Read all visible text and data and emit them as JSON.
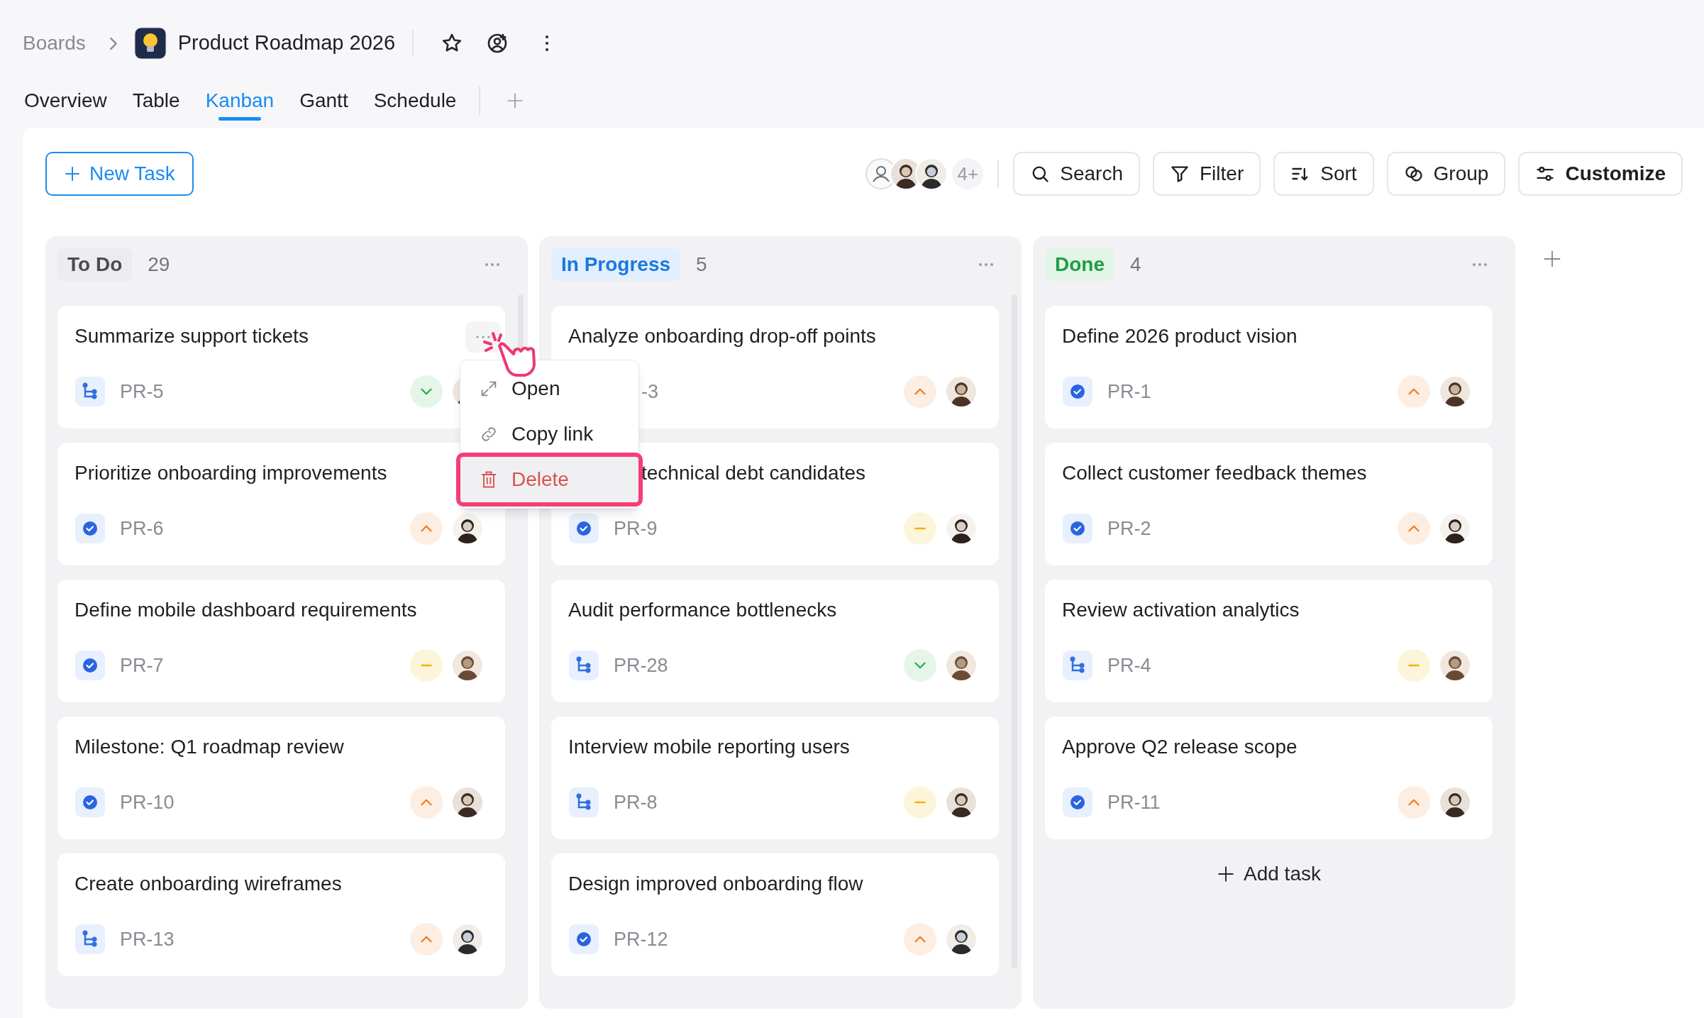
{
  "breadcrumb": {
    "root": "Boards",
    "title": "Product Roadmap 2026"
  },
  "tabs": [
    {
      "label": "Overview",
      "selected": false
    },
    {
      "label": "Table",
      "selected": false
    },
    {
      "label": "Kanban",
      "selected": true
    },
    {
      "label": "Gantt",
      "selected": false
    },
    {
      "label": "Schedule",
      "selected": false
    }
  ],
  "toolbar": {
    "new_task": "New Task",
    "members_more": "4+",
    "buttons": [
      {
        "label": "Search",
        "kind": "search",
        "emphasis": false
      },
      {
        "label": "Filter",
        "kind": "filter",
        "emphasis": false
      },
      {
        "label": "Sort",
        "kind": "sort",
        "emphasis": false
      },
      {
        "label": "Group",
        "kind": "group",
        "emphasis": false
      },
      {
        "label": "Customize",
        "kind": "customize",
        "emphasis": true
      }
    ]
  },
  "columns": [
    {
      "label": "To Do",
      "kind": "todo",
      "count": "29",
      "cards": [
        {
          "title": "Summarize support tickets",
          "id": "PR-5",
          "type": {
            "kind": "subtask"
          },
          "priority": {
            "kind": "low"
          }
        },
        {
          "title": "Prioritize onboarding improvements",
          "id": "PR-6",
          "type": {
            "kind": "task"
          },
          "priority": {
            "kind": "high"
          }
        },
        {
          "title": "Define mobile dashboard requirements",
          "id": "PR-7",
          "type": {
            "kind": "task"
          },
          "priority": {
            "kind": "medium"
          }
        },
        {
          "title": "Milestone: Q1 roadmap review",
          "id": "PR-10",
          "type": {
            "kind": "task"
          },
          "priority": {
            "kind": "high"
          }
        },
        {
          "title": "Create onboarding wireframes",
          "id": "PR-13",
          "type": {
            "kind": "subtask"
          },
          "priority": {
            "kind": "high"
          }
        }
      ]
    },
    {
      "label": "In Progress",
      "kind": "progress",
      "count": "5",
      "cards": [
        {
          "title": "Analyze onboarding drop-off points",
          "id": "-3",
          "covered": true,
          "priority": {
            "kind": "high"
          }
        },
        {
          "title": "technical debt candidates",
          "title_covered": true,
          "id": "PR-9",
          "type": {
            "kind": "task"
          },
          "priority": {
            "kind": "medium"
          }
        },
        {
          "title": "Audit performance bottlenecks",
          "id": "PR-28",
          "type": {
            "kind": "subtask"
          },
          "priority": {
            "kind": "low"
          }
        },
        {
          "title": "Interview mobile reporting users",
          "id": "PR-8",
          "type": {
            "kind": "subtask"
          },
          "priority": {
            "kind": "medium"
          }
        },
        {
          "title": "Design improved onboarding flow",
          "id": "PR-12",
          "type": {
            "kind": "task"
          },
          "priority": {
            "kind": "high"
          }
        }
      ]
    },
    {
      "label": "Done",
      "kind": "done",
      "count": "4",
      "add_task": "Add task",
      "cards": [
        {
          "title": "Define 2026 product vision",
          "id": "PR-1",
          "type": {
            "kind": "task"
          },
          "priority": {
            "kind": "high"
          }
        },
        {
          "title": "Collect customer feedback themes",
          "id": "PR-2",
          "type": {
            "kind": "task"
          },
          "priority": {
            "kind": "high"
          }
        },
        {
          "title": "Review activation analytics",
          "id": "PR-4",
          "type": {
            "kind": "subtask"
          },
          "priority": {
            "kind": "medium"
          }
        },
        {
          "title": "Approve Q2 release scope",
          "id": "PR-11",
          "type": {
            "kind": "task"
          },
          "priority": {
            "kind": "high"
          }
        }
      ]
    }
  ],
  "context_menu": {
    "items": [
      {
        "label": "Open",
        "kind": "open",
        "selected": false
      },
      {
        "label": "Copy link",
        "kind": "link",
        "selected": false
      },
      {
        "label": "Delete",
        "kind": "delete",
        "selected": true
      }
    ]
  }
}
